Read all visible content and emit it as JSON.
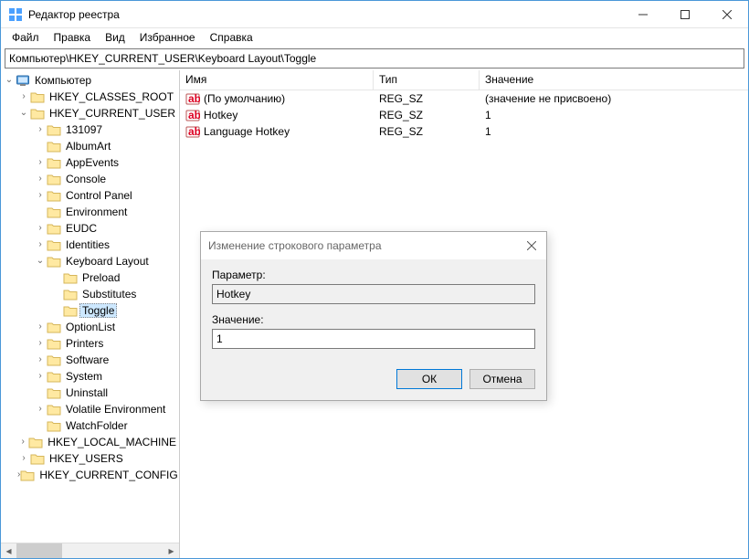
{
  "window": {
    "title": "Редактор реестра"
  },
  "menu": [
    "Файл",
    "Правка",
    "Вид",
    "Избранное",
    "Справка"
  ],
  "path": "Компьютер\\HKEY_CURRENT_USER\\Keyboard Layout\\Toggle",
  "tree": {
    "root": "Компьютер",
    "hives": [
      {
        "label": "HKEY_CLASSES_ROOT",
        "expanded": false,
        "hasChildren": true
      },
      {
        "label": "HKEY_CURRENT_USER",
        "expanded": true,
        "hasChildren": true,
        "children": [
          {
            "label": "131097",
            "hasChildren": true
          },
          {
            "label": "AlbumArt",
            "hasChildren": false
          },
          {
            "label": "AppEvents",
            "hasChildren": true
          },
          {
            "label": "Console",
            "hasChildren": true
          },
          {
            "label": "Control Panel",
            "hasChildren": true
          },
          {
            "label": "Environment",
            "hasChildren": false
          },
          {
            "label": "EUDC",
            "hasChildren": true
          },
          {
            "label": "Identities",
            "hasChildren": true
          },
          {
            "label": "Keyboard Layout",
            "expanded": true,
            "hasChildren": true,
            "children": [
              {
                "label": "Preload",
                "hasChildren": false
              },
              {
                "label": "Substitutes",
                "hasChildren": false
              },
              {
                "label": "Toggle",
                "hasChildren": false,
                "selected": true
              }
            ]
          },
          {
            "label": "OptionList",
            "hasChildren": true
          },
          {
            "label": "Printers",
            "hasChildren": true
          },
          {
            "label": "Software",
            "hasChildren": true
          },
          {
            "label": "System",
            "hasChildren": true
          },
          {
            "label": "Uninstall",
            "hasChildren": false
          },
          {
            "label": "Volatile Environment",
            "hasChildren": true
          },
          {
            "label": "WatchFolder",
            "hasChildren": false
          }
        ]
      },
      {
        "label": "HKEY_LOCAL_MACHINE",
        "expanded": false,
        "hasChildren": true
      },
      {
        "label": "HKEY_USERS",
        "expanded": false,
        "hasChildren": true
      },
      {
        "label": "HKEY_CURRENT_CONFIG",
        "expanded": false,
        "hasChildren": true
      }
    ]
  },
  "list": {
    "columns": {
      "name": "Имя",
      "type": "Тип",
      "value": "Значение"
    },
    "rows": [
      {
        "name": "(По умолчанию)",
        "type": "REG_SZ",
        "value": "(значение не присвоено)"
      },
      {
        "name": "Hotkey",
        "type": "REG_SZ",
        "value": "1"
      },
      {
        "name": "Language Hotkey",
        "type": "REG_SZ",
        "value": "1"
      }
    ]
  },
  "dialog": {
    "title": "Изменение строкового параметра",
    "param_label": "Параметр:",
    "param_value": "Hotkey",
    "value_label": "Значение:",
    "value_value": "1",
    "ok": "ОК",
    "cancel": "Отмена"
  }
}
